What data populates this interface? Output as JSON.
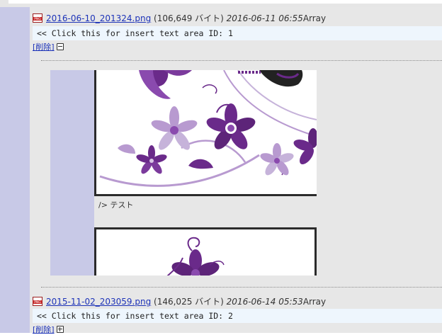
{
  "entries": [
    {
      "file_link": "2016-06-10_201324.png",
      "file_size": "(106,649 バイト)",
      "date": "2016-06-11 06:55",
      "suffix": "Array",
      "insert_text": "<< Click this for insert text area ID: 1",
      "delete_label": "[削除]",
      "toggle_icon": "collapse-icon"
    },
    {
      "file_link": "2015-11-02_203059.png",
      "file_size": "(146,025 バイト)",
      "date": "2016-06-14 05:53",
      "suffix": "Array",
      "insert_text": "<< Click this for insert text area ID: 2",
      "delete_label": "[削除]",
      "toggle_icon": "expand-icon"
    }
  ],
  "preview": {
    "caption": "/> テスト"
  },
  "colors": {
    "sidebar": "#c8c9e7",
    "panel": "#e7e7e7",
    "insert_bar": "#eef6fd",
    "link": "#1d33b8",
    "flower_dark": "#6a2a8a",
    "flower_light": "#b89ad0"
  }
}
